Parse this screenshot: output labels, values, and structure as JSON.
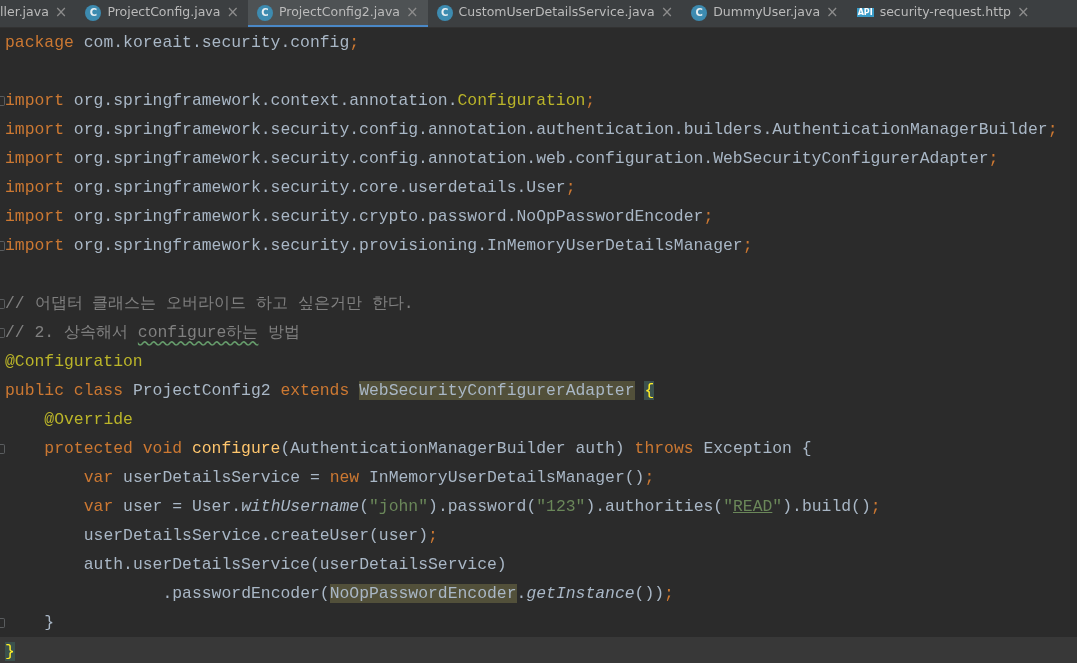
{
  "tabs": [
    {
      "label": "ller.java",
      "kind": "partial",
      "selected": false,
      "close": "×"
    },
    {
      "label": "ProjectConfig.java",
      "kind": "class",
      "badge": "C",
      "selected": false,
      "close": "×"
    },
    {
      "label": "ProjectConfig2.java",
      "kind": "class",
      "badge": "C",
      "selected": true,
      "close": "×"
    },
    {
      "label": "CustomUserDetailsService.java",
      "kind": "class",
      "badge": "C",
      "selected": false,
      "close": "×"
    },
    {
      "label": "DummyUser.java",
      "kind": "class",
      "badge": "C",
      "selected": false,
      "close": "×"
    },
    {
      "label": "security-request.http",
      "kind": "api",
      "badge": "API",
      "selected": false,
      "close": "×"
    }
  ],
  "lines": [
    {
      "kind": "code",
      "fold": false,
      "current": false,
      "tokens": [
        {
          "kind": "kw",
          "t": "package "
        },
        {
          "kind": "plain",
          "t": "com.koreait.security.config"
        },
        {
          "kind": "kw",
          "t": ";"
        }
      ]
    },
    {
      "kind": "blank",
      "fold": false,
      "current": false
    },
    {
      "kind": "code",
      "fold": true,
      "current": false,
      "tokens": [
        {
          "kind": "kw",
          "t": "import "
        },
        {
          "kind": "plain",
          "t": "org.springframework.context.annotation."
        },
        {
          "kind": "ann",
          "t": "Configuration"
        },
        {
          "kind": "kw",
          "t": ";"
        }
      ]
    },
    {
      "kind": "code",
      "fold": false,
      "current": false,
      "tokens": [
        {
          "kind": "kw",
          "t": "import "
        },
        {
          "kind": "plain",
          "t": "org.springframework.security.config.annotation.authentication.builders.AuthenticationManagerBuilder"
        },
        {
          "kind": "kw",
          "t": ";"
        }
      ]
    },
    {
      "kind": "code",
      "fold": false,
      "current": false,
      "tokens": [
        {
          "kind": "kw",
          "t": "import "
        },
        {
          "kind": "plain",
          "t": "org.springframework.security.config.annotation.web.configuration.WebSecurityConfigurerAdapter"
        },
        {
          "kind": "kw",
          "t": ";"
        }
      ]
    },
    {
      "kind": "code",
      "fold": false,
      "current": false,
      "tokens": [
        {
          "kind": "kw",
          "t": "import "
        },
        {
          "kind": "plain",
          "t": "org.springframework.security.core.userdetails.User"
        },
        {
          "kind": "kw",
          "t": ";"
        }
      ]
    },
    {
      "kind": "code",
      "fold": false,
      "current": false,
      "tokens": [
        {
          "kind": "kw",
          "t": "import "
        },
        {
          "kind": "plain",
          "t": "org.springframework.security.crypto.password.NoOpPasswordEncoder"
        },
        {
          "kind": "kw",
          "t": ";"
        }
      ]
    },
    {
      "kind": "code",
      "fold": true,
      "current": false,
      "tokens": [
        {
          "kind": "kw",
          "t": "import "
        },
        {
          "kind": "plain",
          "t": "org.springframework.security.provisioning.InMemoryUserDetailsManager"
        },
        {
          "kind": "kw",
          "t": ";"
        }
      ]
    },
    {
      "kind": "blank",
      "fold": false,
      "current": false
    },
    {
      "kind": "code",
      "fold": true,
      "current": false,
      "tokens": [
        {
          "kind": "comment",
          "t": "// 어댑터 클래스는 오버라이드 하고 싶은거만 한다."
        }
      ]
    },
    {
      "kind": "code",
      "fold": true,
      "current": false,
      "tokens": [
        {
          "kind": "comment",
          "t": "// 2. 상속해서 "
        },
        {
          "kind": "typo",
          "t": "configure하는"
        },
        {
          "kind": "comment",
          "t": " 방법"
        }
      ]
    },
    {
      "kind": "code",
      "fold": false,
      "current": false,
      "tokens": [
        {
          "kind": "ann",
          "t": "@Configuration"
        }
      ]
    },
    {
      "kind": "code",
      "fold": false,
      "current": false,
      "tokens": [
        {
          "kind": "kw",
          "t": "public class "
        },
        {
          "kind": "plain",
          "t": "ProjectConfig2 "
        },
        {
          "kind": "kw",
          "t": "extends "
        },
        {
          "kind": "hl",
          "t": "WebSecurityConfigurerAdapter"
        },
        {
          "kind": "brace",
          "t": "{"
        }
      ],
      "children": [
        {
          "kind": "code",
          "fold": false,
          "current": false,
          "tokens": [
            {
              "kind": "ann",
              "t": "@Override"
            }
          ]
        },
        {
          "kind": "code",
          "fold": true,
          "current": false,
          "tokens": [
            {
              "kind": "kw",
              "t": "protected void "
            },
            {
              "kind": "method",
              "t": "configure"
            },
            {
              "kind": "plain",
              "t": "(AuthenticationManagerBuilder auth) "
            },
            {
              "kind": "kw",
              "t": "throws "
            },
            {
              "kind": "plain",
              "t": "Exception {"
            }
          ],
          "children": [
            {
              "kind": "code",
              "fold": false,
              "current": false,
              "tokens": [
                {
                  "kind": "kw",
                  "t": "var "
                },
                {
                  "kind": "plain",
                  "t": "userDetailsService = "
                },
                {
                  "kind": "kw",
                  "t": "new "
                },
                {
                  "kind": "plain",
                  "t": "InMemoryUserDetailsManager()"
                },
                {
                  "kind": "kw",
                  "t": ";"
                }
              ]
            },
            {
              "kind": "code",
              "fold": false,
              "current": false,
              "tokens": [
                {
                  "kind": "kw",
                  "t": "var "
                },
                {
                  "kind": "plain",
                  "t": "user = User."
                },
                {
                  "kind": "italic",
                  "t": "withUsername"
                },
                {
                  "kind": "plain",
                  "t": "("
                },
                {
                  "kind": "str",
                  "t": "\"john\""
                },
                {
                  "kind": "plain",
                  "t": ").password("
                },
                {
                  "kind": "str",
                  "t": "\"123\""
                },
                {
                  "kind": "plain",
                  "t": ").authorities("
                },
                {
                  "kind": "str",
                  "t": "\""
                },
                {
                  "kind": "strul",
                  "t": "READ"
                },
                {
                  "kind": "str",
                  "t": "\""
                },
                {
                  "kind": "plain",
                  "t": ").build()"
                },
                {
                  "kind": "kw",
                  "t": ";"
                }
              ]
            },
            {
              "kind": "code",
              "fold": false,
              "current": false,
              "tokens": [
                {
                  "kind": "plain",
                  "t": "userDetailsService.createUser(user)"
                },
                {
                  "kind": "kw",
                  "t": ";"
                }
              ]
            },
            {
              "kind": "code",
              "fold": false,
              "current": false,
              "tokens": [
                {
                  "kind": "plain",
                  "t": "auth.userDetailsService(userDetailsService)"
                }
              ],
              "children": [
                {
                  "kind": "continuation",
                  "fold": false,
                  "current": false,
                  "tokens": [
                    {
                      "kind": "plain",
                      "t": ".passwordEncoder("
                    },
                    {
                      "kind": "hl",
                      "t": "NoOpPasswordEncoder"
                    },
                    {
                      "kind": "plain",
                      "t": "."
                    },
                    {
                      "kind": "italic",
                      "t": "getInstance"
                    },
                    {
                      "kind": "plain",
                      "t": "())"
                    },
                    {
                      "kind": "kw",
                      "t": ";"
                    }
                  ]
                }
              ]
            }
          ]
        },
        {
          "kind": "code",
          "fold": true,
          "current": false,
          "tokens": [
            {
              "kind": "plain",
              "t": "}"
            }
          ]
        }
      ]
    },
    {
      "kind": "code",
      "fold": false,
      "current": true,
      "tokens": [
        {
          "kind": "brace",
          "t": "}"
        }
      ]
    }
  ]
}
